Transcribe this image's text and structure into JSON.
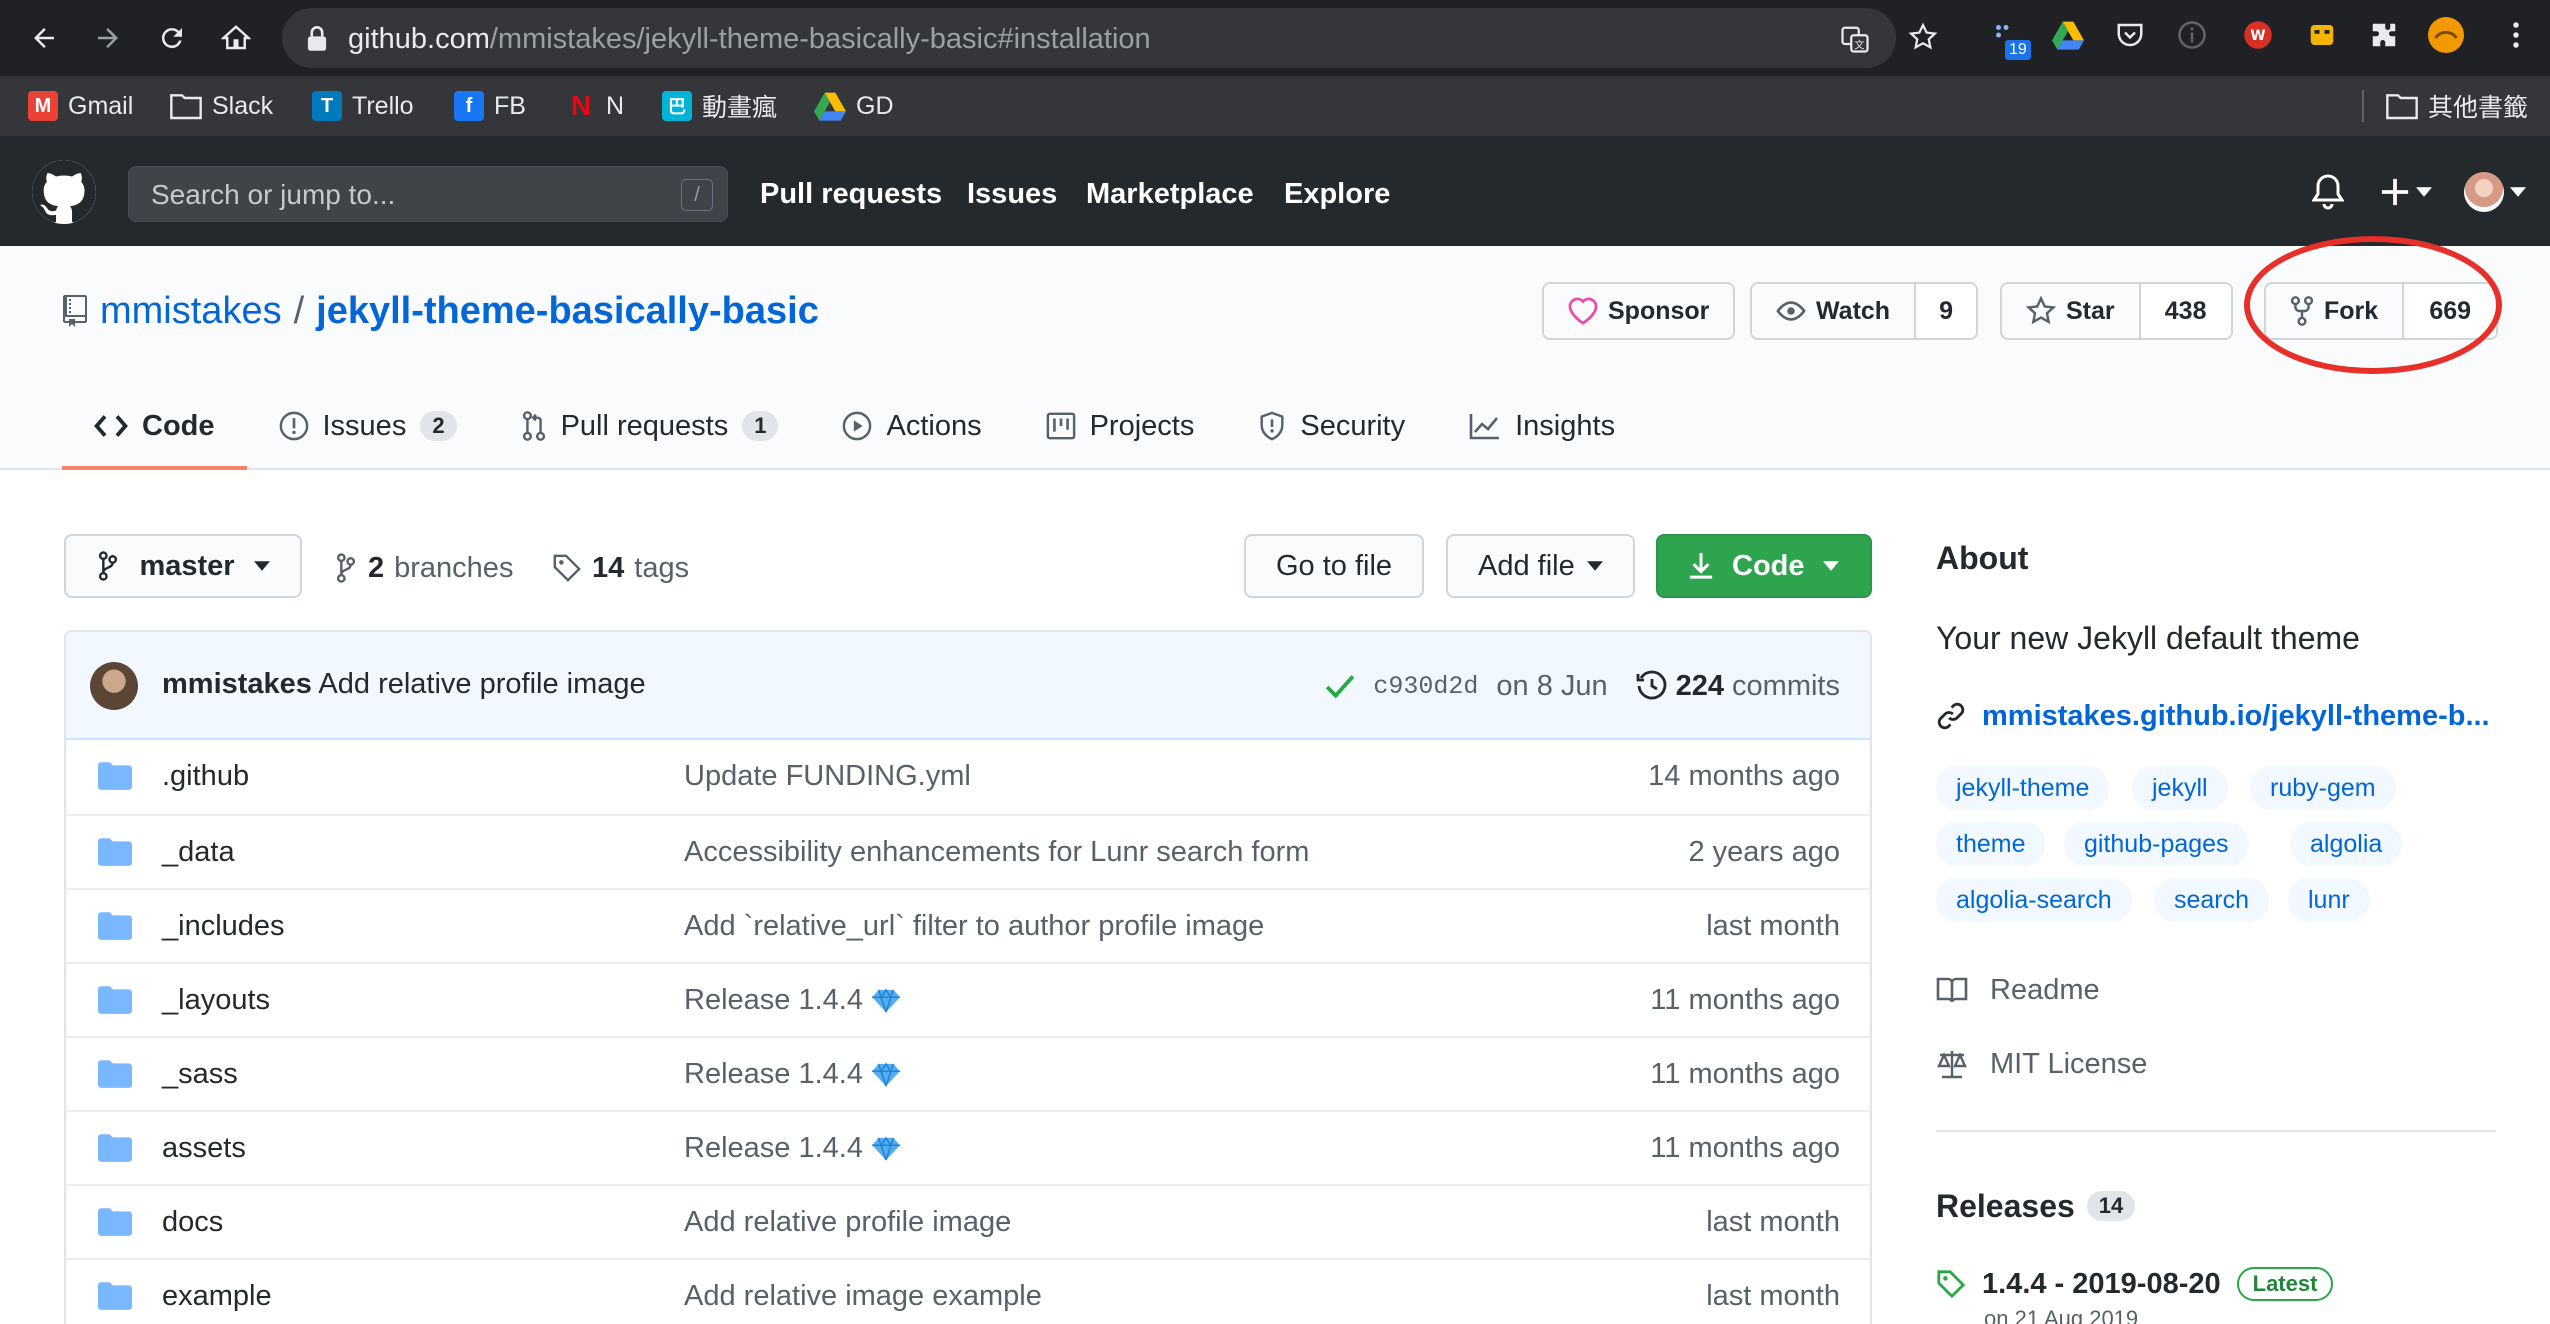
{
  "browser": {
    "url_host": "github.com",
    "url_path": "/mmistakes/jekyll-theme-basically-basic#installation",
    "extension_badge": "19",
    "bookmarks": [
      {
        "label": "Gmail",
        "icon": "gmail-icon",
        "color": "#ea4335",
        "glyph": "M"
      },
      {
        "label": "Slack",
        "icon": "folder-icon",
        "color": "#9aa0a6",
        "glyph": ""
      },
      {
        "label": "Trello",
        "icon": "trello-icon",
        "color": "#0079bf",
        "glyph": "T"
      },
      {
        "label": "FB",
        "icon": "facebook-icon",
        "color": "#1877f2",
        "glyph": "f"
      },
      {
        "label": "N",
        "icon": "netflix-icon",
        "color": "#e50914",
        "glyph": "N"
      },
      {
        "label": "動畫瘋",
        "icon": "ani-gamer-icon",
        "color": "#00b4d8",
        "glyph": "巴"
      },
      {
        "label": "GD",
        "icon": "google-drive-icon",
        "color": "#34a853",
        "glyph": "▲"
      }
    ],
    "other_bookmarks": "其他書籤"
  },
  "header": {
    "search_placeholder": "Search or jump to...",
    "search_key": "/",
    "nav": [
      "Pull requests",
      "Issues",
      "Marketplace",
      "Explore"
    ]
  },
  "repo": {
    "owner": "mmistakes",
    "separator": "/",
    "name": "jekyll-theme-basically-basic",
    "sponsor_label": "Sponsor",
    "watch_label": "Watch",
    "watch_count": "9",
    "star_label": "Star",
    "star_count": "438",
    "fork_label": "Fork",
    "fork_count": "669",
    "tabs": [
      {
        "label": "Code",
        "count": ""
      },
      {
        "label": "Issues",
        "count": "2"
      },
      {
        "label": "Pull requests",
        "count": "1"
      },
      {
        "label": "Actions",
        "count": ""
      },
      {
        "label": "Projects",
        "count": ""
      },
      {
        "label": "Security",
        "count": ""
      },
      {
        "label": "Insights",
        "count": ""
      }
    ]
  },
  "toolbar": {
    "branch": "master",
    "branches_count": "2",
    "branches_label": "branches",
    "tags_count": "14",
    "tags_label": "tags",
    "go_to_file": "Go to file",
    "add_file": "Add file",
    "code": "Code"
  },
  "commit": {
    "author": "mmistakes",
    "message": "Add relative profile image",
    "sha": "c930d2d",
    "date": "on 8 Jun",
    "count": "224",
    "count_label": "commits"
  },
  "files": [
    {
      "name": ".github",
      "message": "Update FUNDING.yml",
      "age": "14 months ago",
      "gem": false
    },
    {
      "name": "_data",
      "message": "Accessibility enhancements for Lunr search form",
      "age": "2 years ago",
      "gem": false
    },
    {
      "name": "_includes",
      "message": "Add `relative_url` filter to author profile image",
      "age": "last month",
      "gem": false
    },
    {
      "name": "_layouts",
      "message": "Release 1.4.4",
      "age": "11 months ago",
      "gem": true
    },
    {
      "name": "_sass",
      "message": "Release 1.4.4",
      "age": "11 months ago",
      "gem": true
    },
    {
      "name": "assets",
      "message": "Release 1.4.4",
      "age": "11 months ago",
      "gem": true
    },
    {
      "name": "docs",
      "message": "Add relative profile image",
      "age": "last month",
      "gem": false
    },
    {
      "name": "example",
      "message": "Add relative image example",
      "age": "last month",
      "gem": false
    }
  ],
  "about": {
    "heading": "About",
    "description": "Your new Jekyll default theme",
    "link": "mmistakes.github.io/jekyll-theme-b...",
    "topics": [
      "jekyll-theme",
      "jekyll",
      "ruby-gem",
      "theme",
      "github-pages",
      "algolia",
      "algolia-search",
      "search",
      "lunr"
    ],
    "readme": "Readme",
    "license": "MIT License"
  },
  "releases": {
    "heading": "Releases",
    "count": "14",
    "latest_name": "1.4.4 - 2019-08-20",
    "latest_badge": "Latest",
    "latest_date": "on 21 Aug 2019"
  },
  "colors": {
    "accent": "#0366d6",
    "primary_button": "#2ea44f",
    "active_tab_underline": "#f9826c",
    "highlight_circle": "#e7302a",
    "folder": "#79b8ff"
  }
}
